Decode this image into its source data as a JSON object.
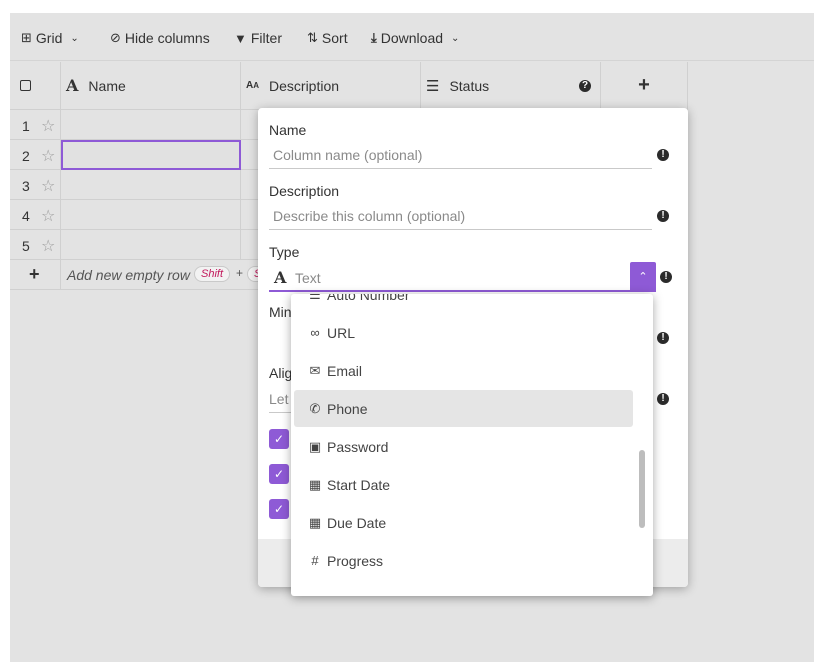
{
  "toolbar": {
    "grid_label": "Grid",
    "hide_columns_label": "Hide columns",
    "filter_label": "Filter",
    "sort_label": "Sort",
    "download_label": "Download"
  },
  "grid": {
    "columns": [
      {
        "label": "Name",
        "icon": "A"
      },
      {
        "label": "Description",
        "icon": "AA"
      },
      {
        "label": "Status",
        "icon": "list"
      }
    ],
    "rows": [
      "1",
      "2",
      "3",
      "4",
      "5"
    ],
    "add_row_label": "Add new empty row",
    "add_row_shortcut": "Shift",
    "add_row_plus": "+",
    "add_row_extra": "S"
  },
  "dialog": {
    "name_label": "Name",
    "name_placeholder": "Column name (optional)",
    "description_label": "Description",
    "description_placeholder": "Describe this column (optional)",
    "type_label": "Type",
    "type_value": "Text",
    "min_label_partial": "Min",
    "align_label_partial": "Alig",
    "align_value_partial": "Let"
  },
  "type_options": [
    {
      "label": "Auto Number",
      "icon": "list-icon"
    },
    {
      "label": "URL",
      "icon": "link-icon"
    },
    {
      "label": "Email",
      "icon": "envelope-icon"
    },
    {
      "label": "Phone",
      "icon": "phone-icon"
    },
    {
      "label": "Password",
      "icon": "lock-icon"
    },
    {
      "label": "Start Date",
      "icon": "calendar-icon"
    },
    {
      "label": "Due Date",
      "icon": "calendar-icon"
    },
    {
      "label": "Progress",
      "icon": "hash-icon"
    }
  ],
  "colors": {
    "accent": "#8e5ad6",
    "background": "#e3e3e3"
  }
}
